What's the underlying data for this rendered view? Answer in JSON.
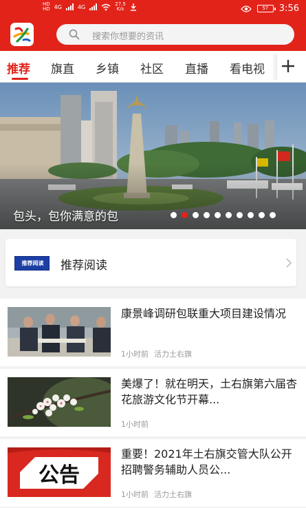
{
  "status_bar": {
    "sim": [
      "HD",
      "HD"
    ],
    "net_left": "4G",
    "net_right": "4G",
    "speed_value": "27.5",
    "speed_unit": "K/s",
    "battery": "57",
    "time": "3:56"
  },
  "search": {
    "placeholder": "搜索你想要的资讯"
  },
  "tabs": [
    {
      "label": "推荐",
      "active": true
    },
    {
      "label": "旗直",
      "active": false
    },
    {
      "label": "乡镇",
      "active": false
    },
    {
      "label": "社区",
      "active": false
    },
    {
      "label": "直播",
      "active": false
    },
    {
      "label": "看电视",
      "active": false
    }
  ],
  "banner": {
    "caption": "包头，包你满意的包",
    "dot_count": 10,
    "active_dot": 1
  },
  "recommend": {
    "badge": "推荐阅读",
    "label": "推荐阅读"
  },
  "news": [
    {
      "title": "康景峰调研包联重大项目建设情况",
      "time": "1小时前",
      "source": "活力土右旗",
      "thumb": "meeting-photo"
    },
    {
      "title": "美爆了！就在明天，土右旗第六届杏花旅游文化节开幕...",
      "time": "1小时前",
      "source": "",
      "thumb": "apricot-blossom-photo"
    },
    {
      "title": "重要！2021年土右旗交管大队公开招聘警务辅助人员公...",
      "time": "1小时前",
      "source": "活力土右旗",
      "thumb": "announcement-image",
      "thumb_text": "公告"
    }
  ],
  "colors": {
    "brand": "#e2231a",
    "badge_blue": "#1d3fa5"
  }
}
